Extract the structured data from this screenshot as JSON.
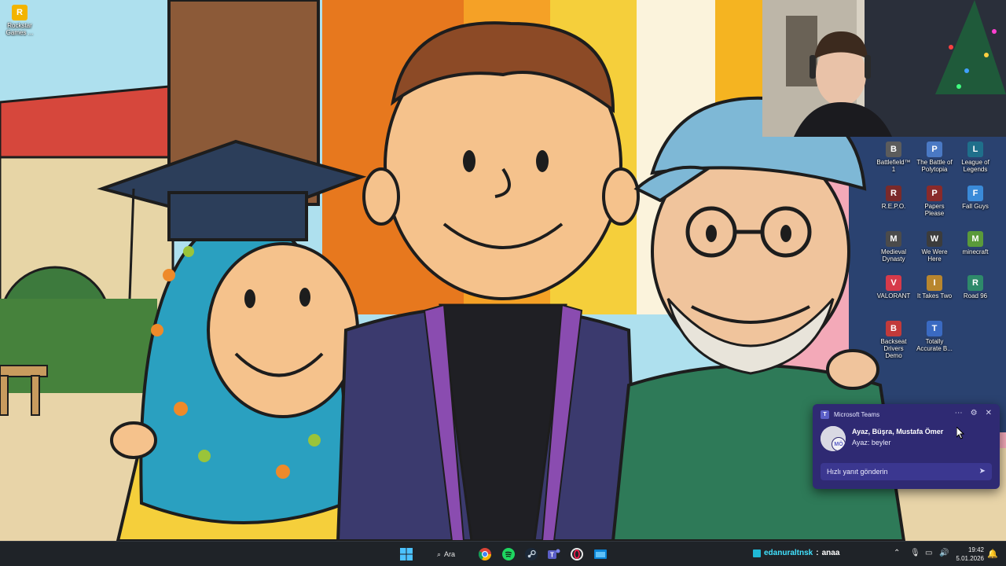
{
  "desktop": {
    "icons_left": [
      {
        "label": "Rockstar Games ...",
        "glyph": "R",
        "color": "#f2b400"
      }
    ],
    "icons_right": [
      {
        "label": "Battlefield™ 1",
        "glyph": "B",
        "color": "#5c5c5c"
      },
      {
        "label": "The Battle of Polytopia",
        "glyph": "P",
        "color": "#4a79c4"
      },
      {
        "label": "League of Legends",
        "glyph": "L",
        "color": "#1f6f8b"
      },
      {
        "label": "R.E.P.O.",
        "glyph": "R",
        "color": "#7a2a2a"
      },
      {
        "label": "Papers Please",
        "glyph": "P",
        "color": "#8a2a2a"
      },
      {
        "label": "Fall Guys",
        "glyph": "F",
        "color": "#3a8ad8"
      },
      {
        "label": "Medieval Dynasty",
        "glyph": "M",
        "color": "#4b4b4b"
      },
      {
        "label": "We Were Here",
        "glyph": "W",
        "color": "#3c3c3c"
      },
      {
        "label": "minecraft",
        "glyph": "M",
        "color": "#5a9a3a"
      },
      {
        "label": "VALORANT",
        "glyph": "V",
        "color": "#d63a4a"
      },
      {
        "label": "It Takes Two",
        "glyph": "I",
        "color": "#b8862e"
      },
      {
        "label": "Road 96",
        "glyph": "R",
        "color": "#2e8a6a"
      },
      {
        "label": "Backseat Drivers Demo",
        "glyph": "B",
        "color": "#c23a3a"
      },
      {
        "label": "Totally Accurate B...",
        "glyph": "T",
        "color": "#3a6ac2"
      }
    ]
  },
  "notification": {
    "app_name": "Microsoft Teams",
    "title": "Ayaz, Büşra, Mustafa Ömer",
    "message": "Ayaz: beyler",
    "reply_placeholder": "Hızlı yanıt gönderin",
    "avatar_initials": "MÖ",
    "accent": "#2f2a73"
  },
  "taskbar": {
    "search_label": "Ara",
    "pinned": [
      "start-icon",
      "chrome-icon",
      "spotify-icon",
      "steam-icon",
      "teams-icon",
      "opera-gx-icon",
      "app-window-icon"
    ],
    "now_playing": {
      "user": "edanuraltnsk",
      "separator": ":",
      "text": "anaa"
    },
    "clock": {
      "time": "19:42",
      "date": "5.01.2026"
    }
  }
}
